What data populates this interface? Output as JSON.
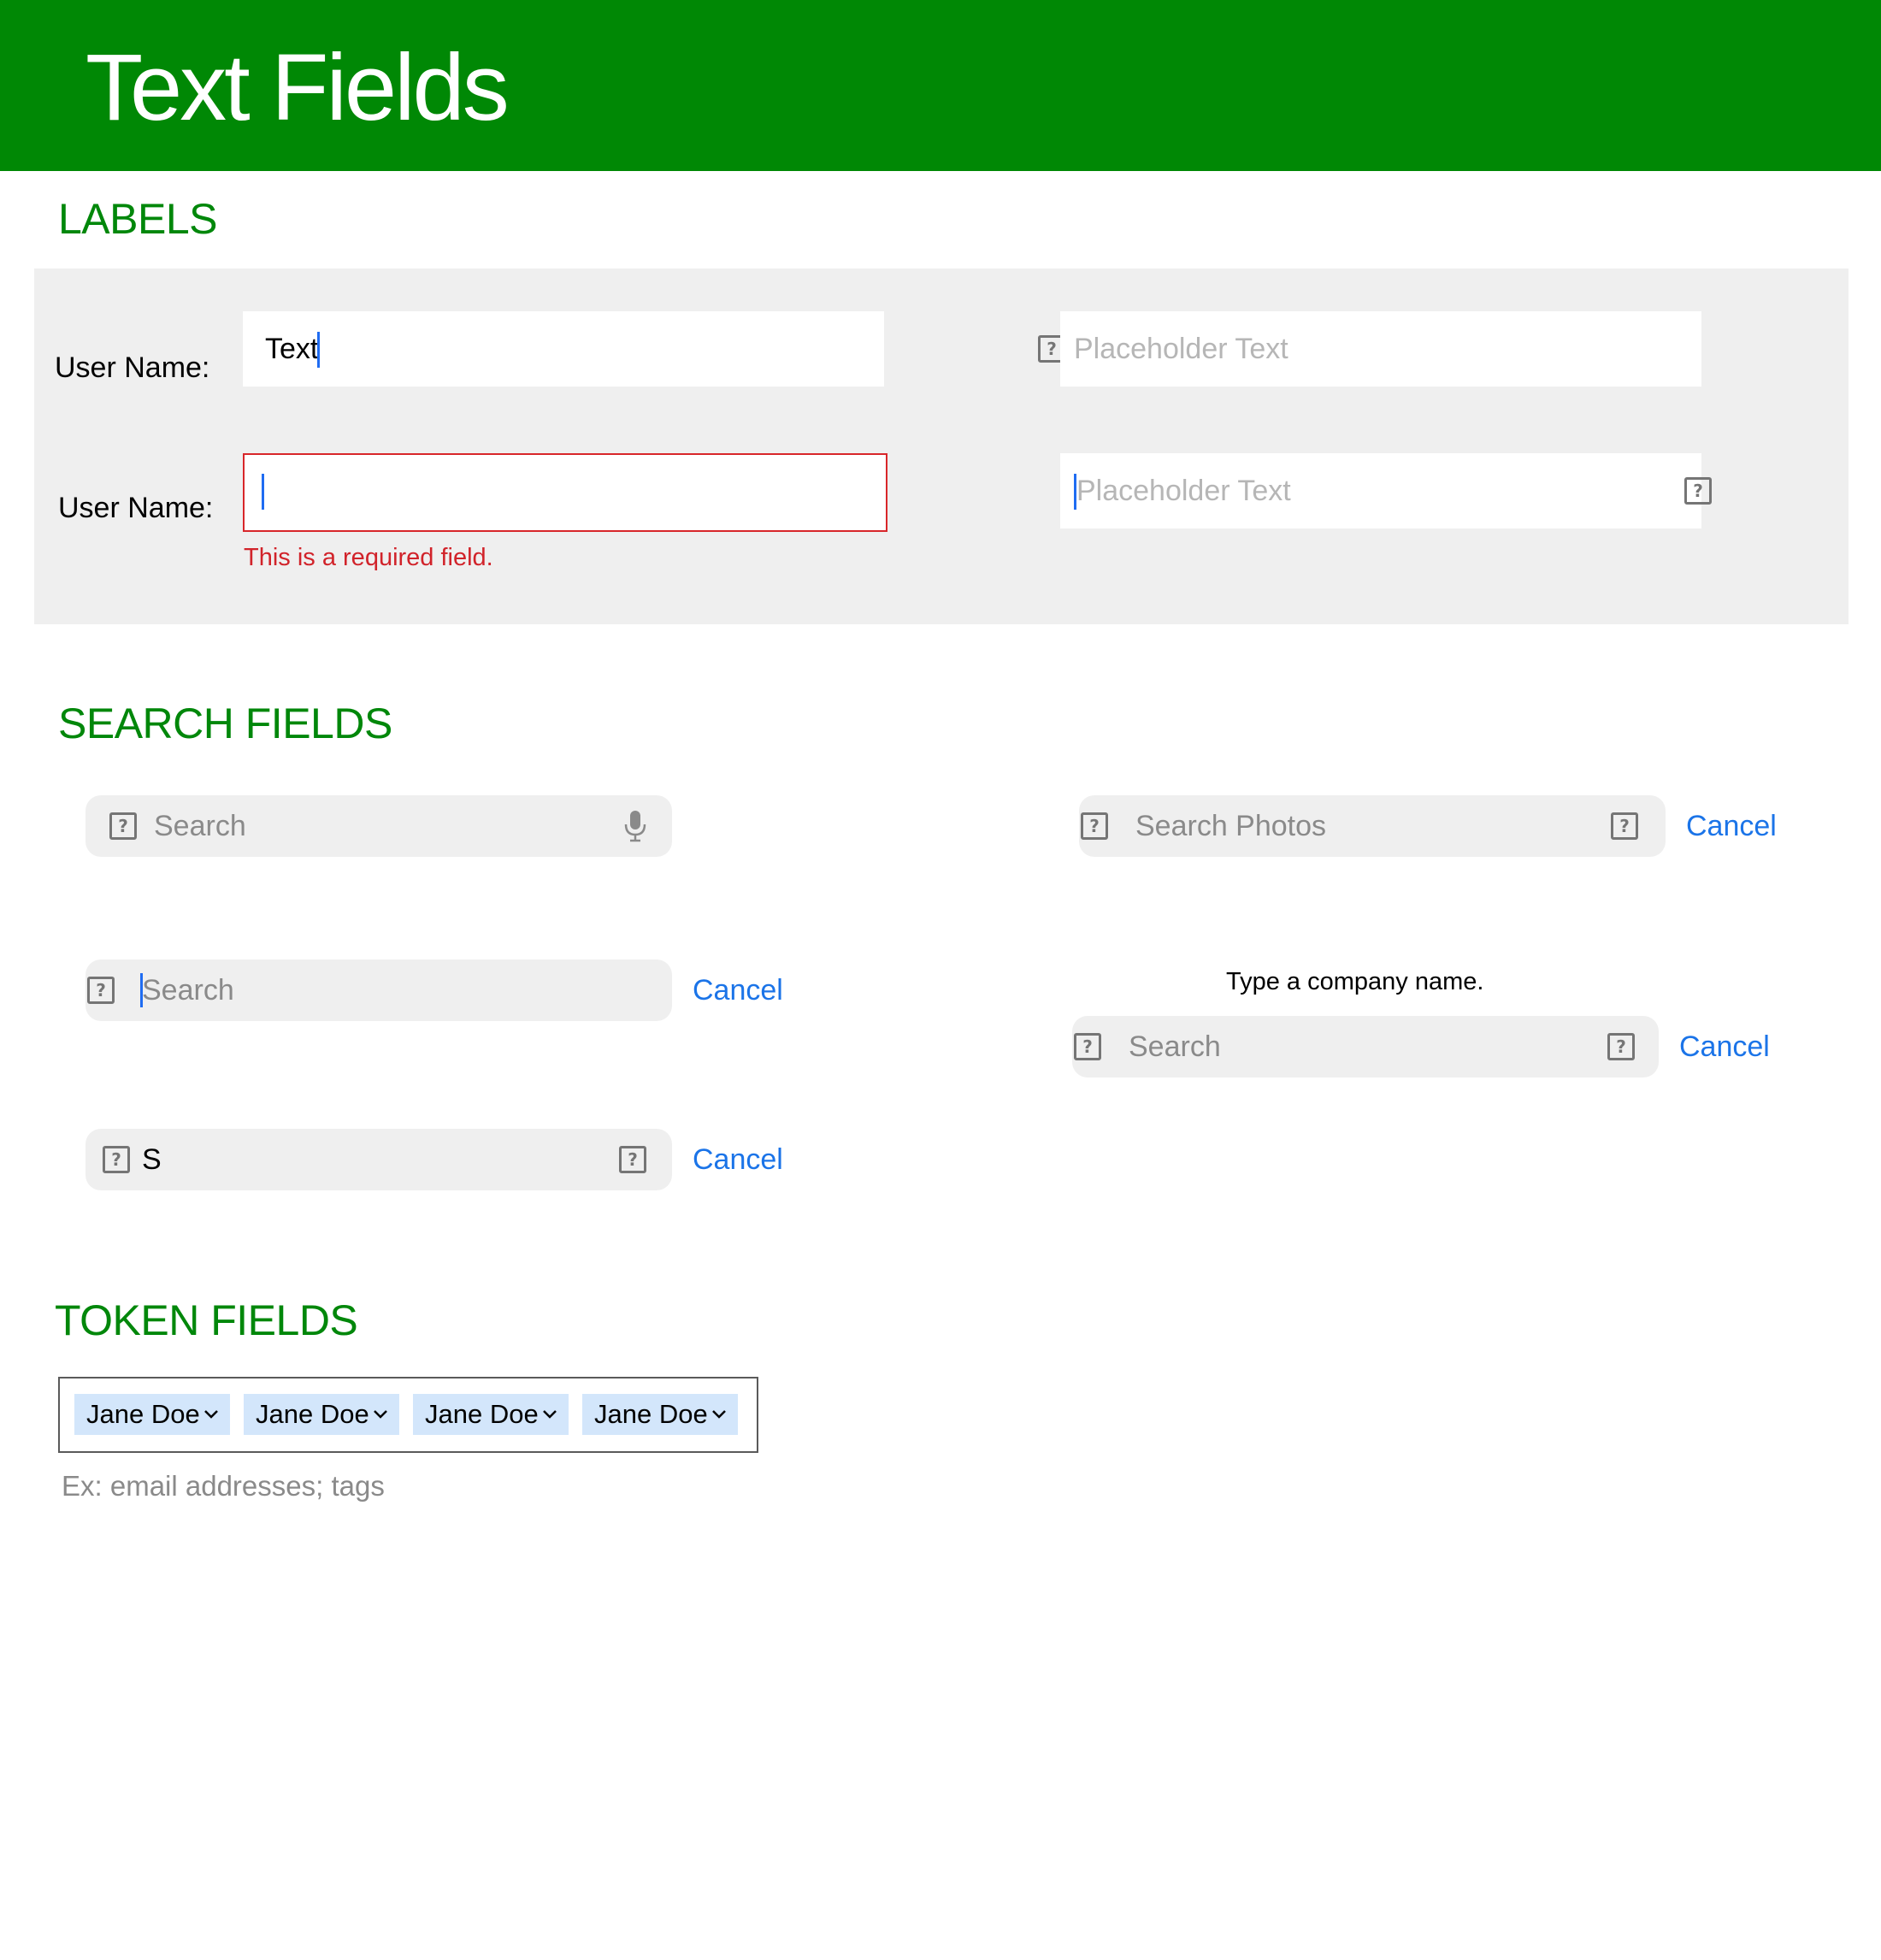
{
  "header": {
    "title": "Text Fields"
  },
  "labels_section": {
    "title": "LABELS",
    "row1": {
      "label": "User Name:",
      "field_value": "Text",
      "right_placeholder": "Placeholder Text"
    },
    "row2": {
      "label": "User Name:",
      "field_value": "",
      "error": "This is a required field.",
      "right_placeholder": "Placeholder Text"
    }
  },
  "search_section": {
    "title": "SEARCH FIELDS",
    "search1": {
      "placeholder": "Search"
    },
    "search2": {
      "placeholder": "Search",
      "cancel": "Cancel"
    },
    "search3": {
      "value": "S",
      "cancel": "Cancel"
    },
    "search4": {
      "placeholder": "Search Photos",
      "cancel": "Cancel"
    },
    "search5": {
      "prompt": "Type a company name.",
      "placeholder": "Search",
      "cancel": "Cancel"
    }
  },
  "token_section": {
    "title": "TOKEN FIELDS",
    "tokens": [
      "Jane Doe",
      "Jane Doe",
      "Jane Doe",
      "Jane Doe"
    ],
    "hint": "Ex: email addresses; tags"
  },
  "icons": {
    "placeholder_glyph": "?",
    "chevron": "⌄"
  },
  "colors": {
    "header_bg": "#008805",
    "section_title": "#00870a",
    "accent_blue": "#1b74e8",
    "error_red": "#d1232a",
    "panel_bg": "#efefef",
    "token_bg": "#d3e6fb"
  }
}
